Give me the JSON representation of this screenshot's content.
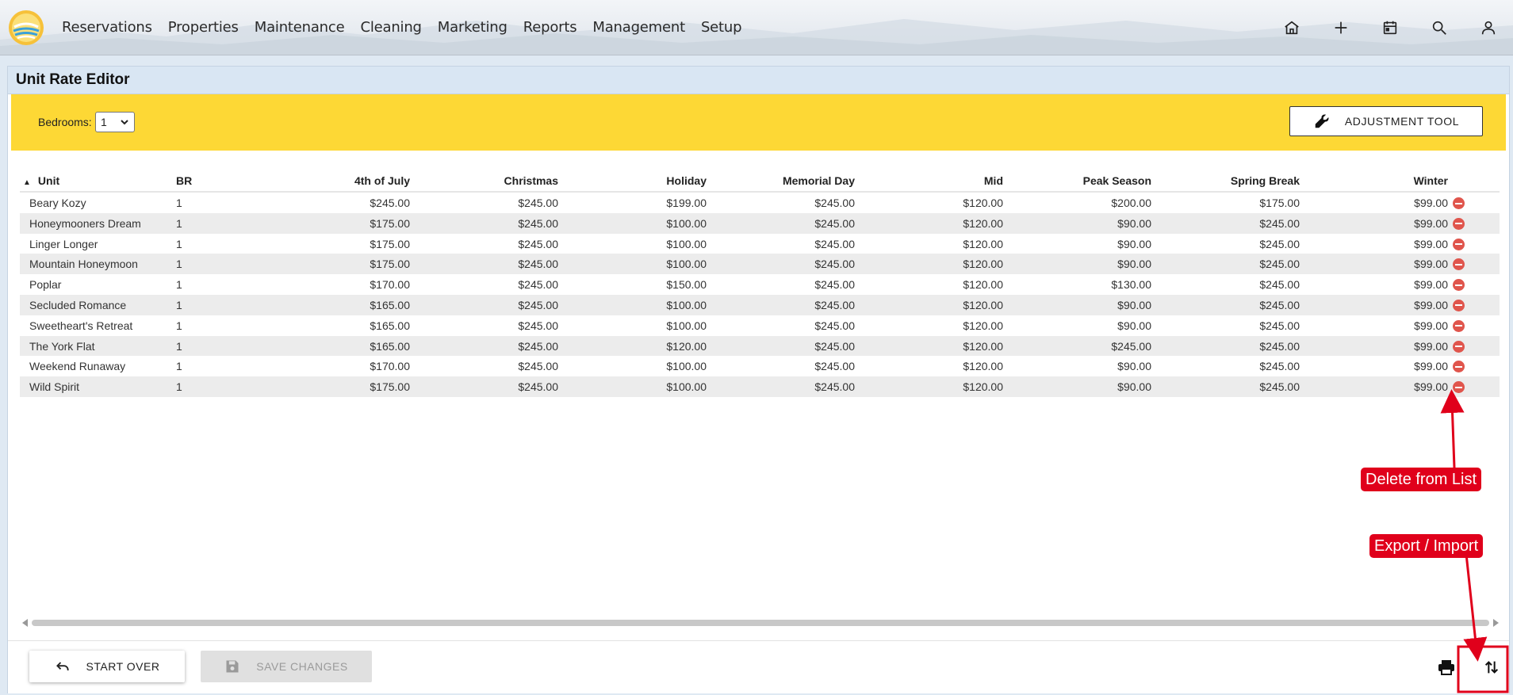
{
  "nav": {
    "items": [
      "Reservations",
      "Properties",
      "Maintenance",
      "Cleaning",
      "Marketing",
      "Reports",
      "Management",
      "Setup"
    ],
    "icons": [
      "home-icon",
      "plus-icon",
      "calendar-icon",
      "search-icon",
      "user-icon"
    ]
  },
  "panel": {
    "title": "Unit Rate Editor",
    "bedrooms_label": "Bedrooms:",
    "bedrooms_value": "1",
    "adjustment_label": "ADJUSTMENT TOOL"
  },
  "table": {
    "columns": [
      "Unit",
      "BR",
      "4th of July",
      "Christmas",
      "Holiday",
      "Memorial Day",
      "Mid",
      "Peak Season",
      "Spring Break",
      "Winter"
    ],
    "rows": [
      [
        "Beary Kozy",
        "1",
        "$245.00",
        "$245.00",
        "$199.00",
        "$245.00",
        "$120.00",
        "$200.00",
        "$175.00",
        "$99.00"
      ],
      [
        "Honeymooners Dream",
        "1",
        "$175.00",
        "$245.00",
        "$100.00",
        "$245.00",
        "$120.00",
        "$90.00",
        "$245.00",
        "$99.00"
      ],
      [
        "Linger Longer",
        "1",
        "$175.00",
        "$245.00",
        "$100.00",
        "$245.00",
        "$120.00",
        "$90.00",
        "$245.00",
        "$99.00"
      ],
      [
        "Mountain Honeymoon",
        "1",
        "$175.00",
        "$245.00",
        "$100.00",
        "$245.00",
        "$120.00",
        "$90.00",
        "$245.00",
        "$99.00"
      ],
      [
        "Poplar",
        "1",
        "$170.00",
        "$245.00",
        "$150.00",
        "$245.00",
        "$120.00",
        "$130.00",
        "$245.00",
        "$99.00"
      ],
      [
        "Secluded Romance",
        "1",
        "$165.00",
        "$245.00",
        "$100.00",
        "$245.00",
        "$120.00",
        "$90.00",
        "$245.00",
        "$99.00"
      ],
      [
        "Sweetheart's Retreat",
        "1",
        "$165.00",
        "$245.00",
        "$100.00",
        "$245.00",
        "$120.00",
        "$90.00",
        "$245.00",
        "$99.00"
      ],
      [
        "The York Flat",
        "1",
        "$165.00",
        "$245.00",
        "$120.00",
        "$245.00",
        "$120.00",
        "$245.00",
        "$245.00",
        "$99.00"
      ],
      [
        "Weekend Runaway",
        "1",
        "$170.00",
        "$245.00",
        "$100.00",
        "$245.00",
        "$120.00",
        "$90.00",
        "$245.00",
        "$99.00"
      ],
      [
        "Wild Spirit",
        "1",
        "$175.00",
        "$245.00",
        "$100.00",
        "$245.00",
        "$120.00",
        "$90.00",
        "$245.00",
        "$99.00"
      ]
    ]
  },
  "footer": {
    "start_over": "START OVER",
    "save_changes": "SAVE CHANGES"
  },
  "annotations": {
    "delete": "Delete from List",
    "export": "Export / Import"
  },
  "colors": {
    "toolbar_yellow": "#fdd835",
    "panel_header": "#d9e6f3",
    "delete_red": "#e0554c",
    "annotation_red": "#e0001b"
  }
}
